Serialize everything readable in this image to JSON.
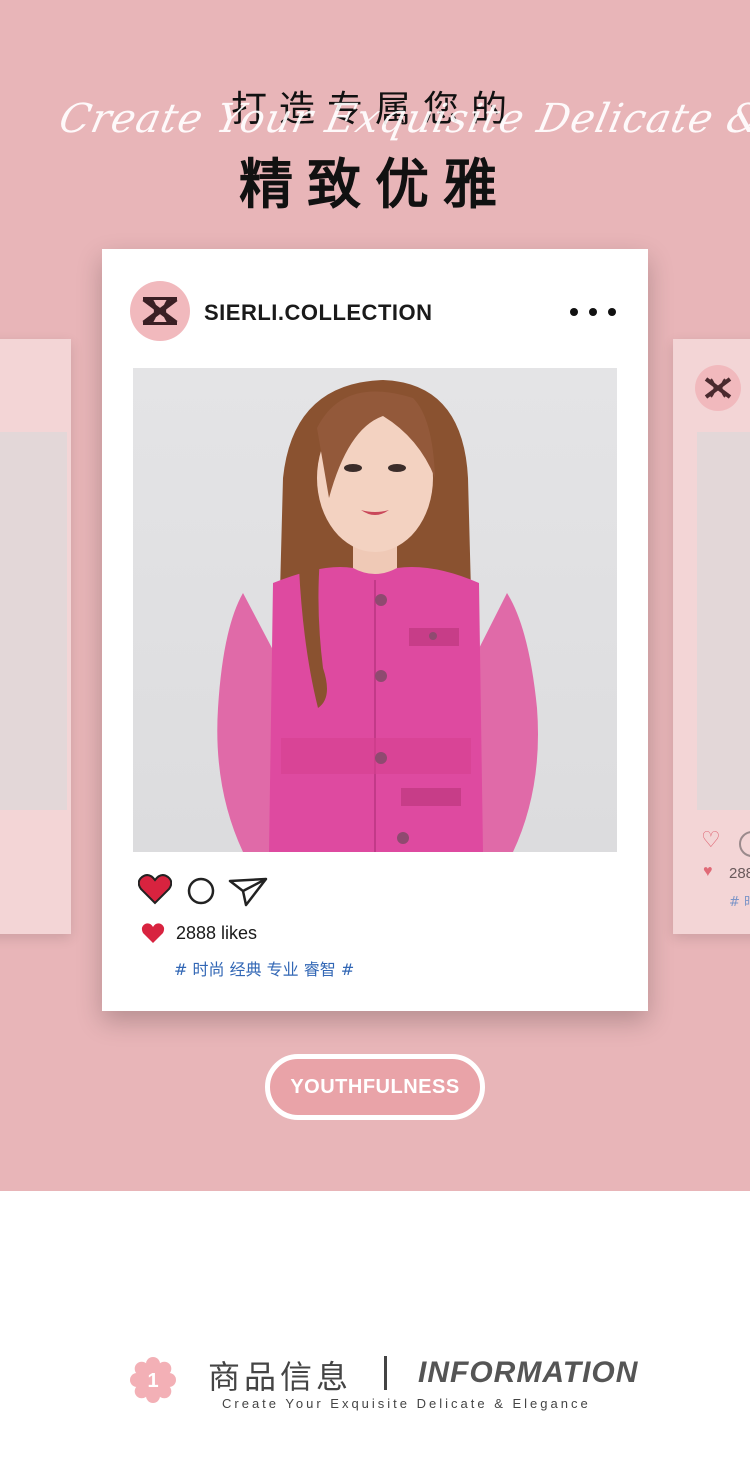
{
  "header": {
    "line1": "打造专属您的",
    "line2": "精致优雅",
    "script": "Create Your Exquisite Delicate & Elegance"
  },
  "post": {
    "username": "SIERLI.COLLECTION",
    "likes": "2888 likes",
    "tags": "# 时尚 经典 专业 睿智 #",
    "icons": [
      "brand-logo-icon",
      "more-icon",
      "heart-icon",
      "comment-icon",
      "share-icon"
    ]
  },
  "ghost_right": {
    "likes": "288",
    "tags": "# 时"
  },
  "button": {
    "label": "YOUTHFULNESS"
  },
  "section": {
    "number": "1",
    "title_cn": "商品信息",
    "title_en": "INFORMATION",
    "subtitle": "Create Your Exquisite Delicate & Elegance"
  },
  "colors": {
    "background_pink": "#e8b5b8",
    "card_ghost": "#f3d5d6",
    "heart_red": "#d8233f",
    "tag_blue": "#3267b5",
    "dress_pink": "#e0489c"
  }
}
